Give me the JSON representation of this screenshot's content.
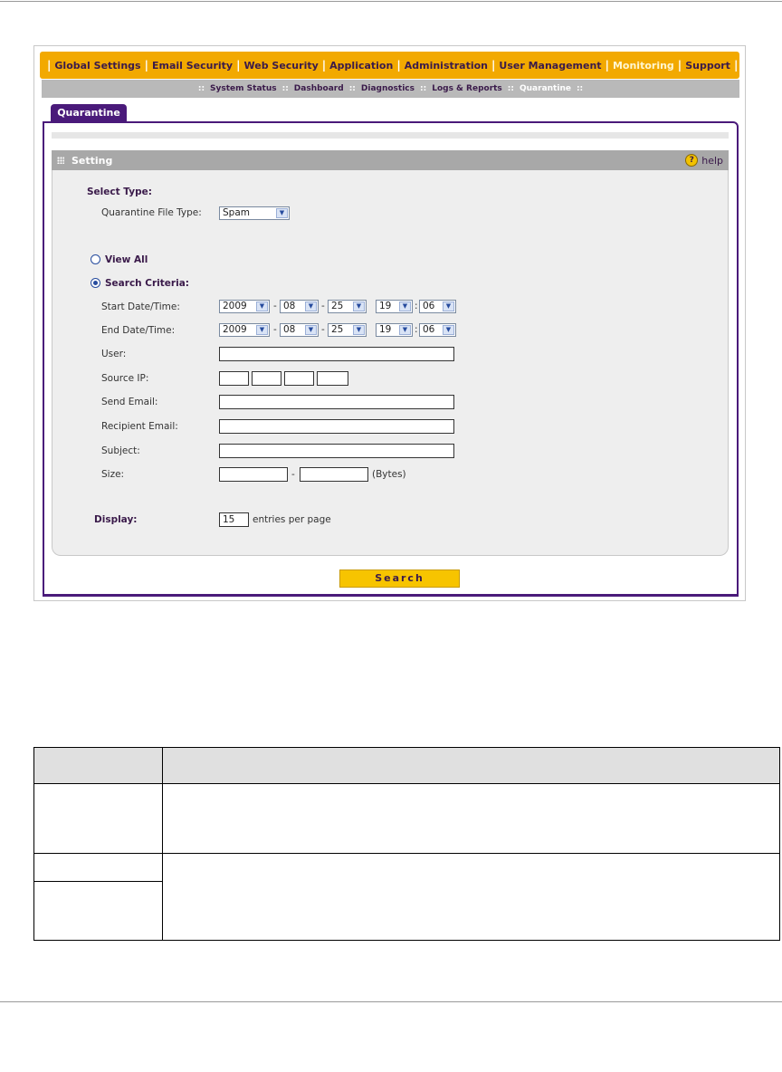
{
  "top_nav": {
    "items": [
      {
        "label": "Global Settings",
        "active": false
      },
      {
        "label": "Email Security",
        "active": false
      },
      {
        "label": "Web Security",
        "active": false
      },
      {
        "label": "Application",
        "active": false
      },
      {
        "label": "Administration",
        "active": false
      },
      {
        "label": "User Management",
        "active": false
      },
      {
        "label": "Monitoring",
        "active": true
      },
      {
        "label": "Support",
        "active": false
      }
    ]
  },
  "sub_nav": {
    "items": [
      {
        "label": "System Status",
        "active": false
      },
      {
        "label": "Dashboard",
        "active": false
      },
      {
        "label": "Diagnostics",
        "active": false
      },
      {
        "label": "Logs & Reports",
        "active": false
      },
      {
        "label": "Quarantine",
        "active": true
      }
    ]
  },
  "tab": {
    "label": "Quarantine"
  },
  "section": {
    "title": "Setting",
    "help_label": "help"
  },
  "form": {
    "select_type_label": "Select Type:",
    "file_type_label": "Quarantine File Type:",
    "file_type_value": "Spam",
    "view_all_label": "View All",
    "search_criteria_label": "Search Criteria:",
    "selected_option": "search_criteria",
    "start_label": "Start Date/Time:",
    "start": {
      "year": "2009",
      "month": "08",
      "day": "25",
      "hour": "19",
      "minute": "06"
    },
    "end_label": "End Date/Time:",
    "end": {
      "year": "2009",
      "month": "08",
      "day": "25",
      "hour": "19",
      "minute": "06"
    },
    "user_label": "User:",
    "source_ip_label": "Source IP:",
    "send_email_label": "Send Email:",
    "recipient_email_label": "Recipient Email:",
    "subject_label": "Subject:",
    "size_label": "Size:",
    "size_dash": "-",
    "bytes_label": "(Bytes)",
    "date_dash": "-",
    "time_colon": ":",
    "display_label": "Display:",
    "display_value": "15",
    "entries_label": "entries per page"
  },
  "search_button": {
    "label": "Search"
  },
  "colors": {
    "nav_bar": "#f2a900",
    "accent": "#4a1a7a",
    "button": "#f7c400"
  }
}
